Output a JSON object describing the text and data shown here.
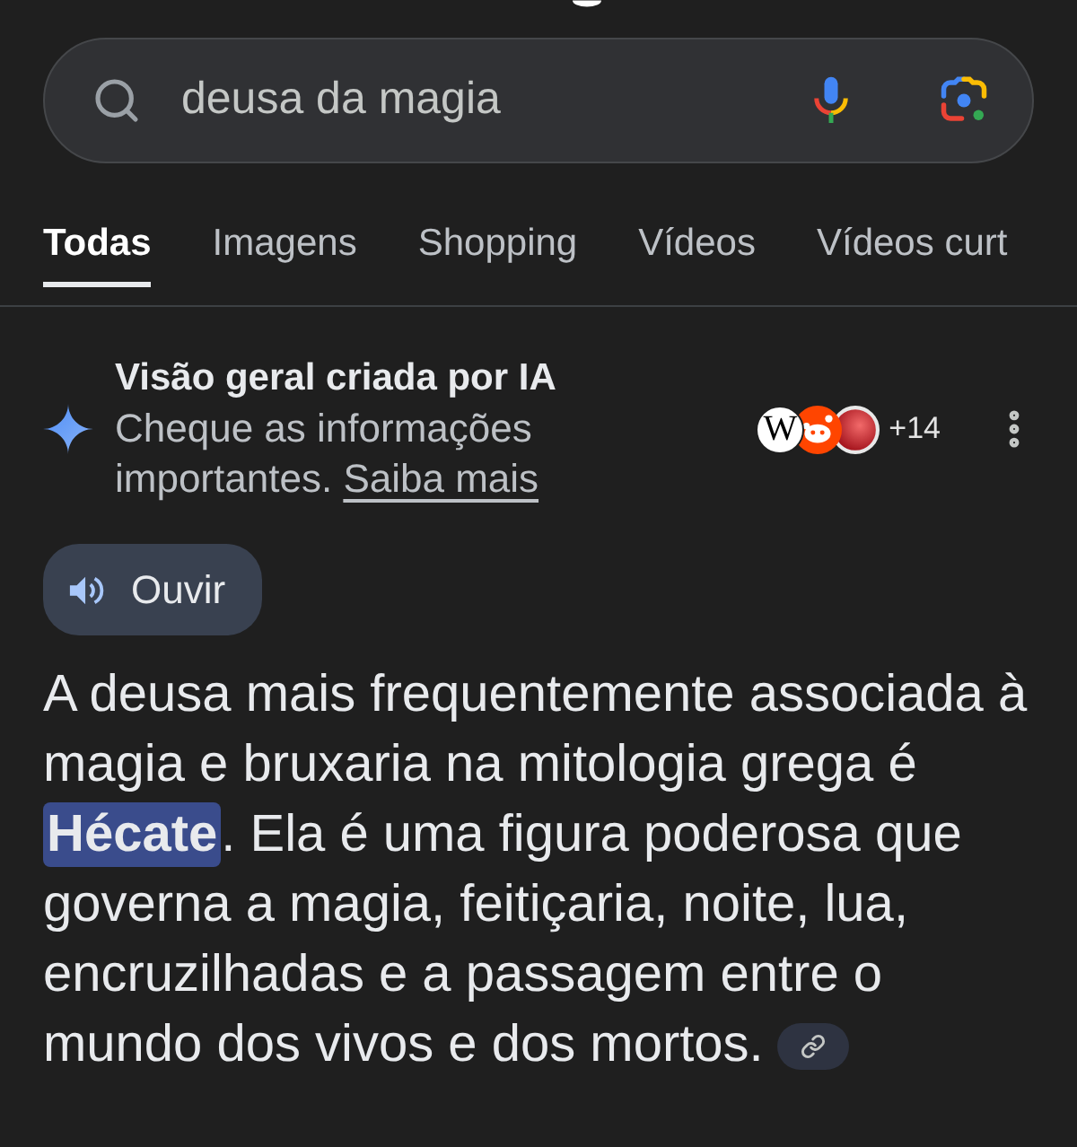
{
  "search": {
    "value": "deusa da magia"
  },
  "tabs": [
    {
      "label": "Todas",
      "selected": true
    },
    {
      "label": "Imagens",
      "selected": false
    },
    {
      "label": "Shopping",
      "selected": false
    },
    {
      "label": "Vídeos",
      "selected": false
    },
    {
      "label": "Vídeos curt",
      "selected": false
    }
  ],
  "ai_overview": {
    "title": "Visão geral criada por IA",
    "notice": "Cheque as informações importantes.",
    "learn_more_link": "Saiba mais",
    "sources": [
      {
        "kind": "letter",
        "label": "W"
      },
      {
        "kind": "mascot"
      },
      {
        "kind": "sphere"
      }
    ],
    "source_count": "+14"
  },
  "listen_button": {
    "label": "Ouvir"
  },
  "answer": {
    "text": "A deusa mais frequentemente associada à magia e bruxaria na mitologia grega é **Hécate**. Ela é uma figura poderosa que governa a magia, feitiçaria, noite, lua, encruzilhadas e a passagem entre o mundo dos vivos e dos mortos."
  }
}
